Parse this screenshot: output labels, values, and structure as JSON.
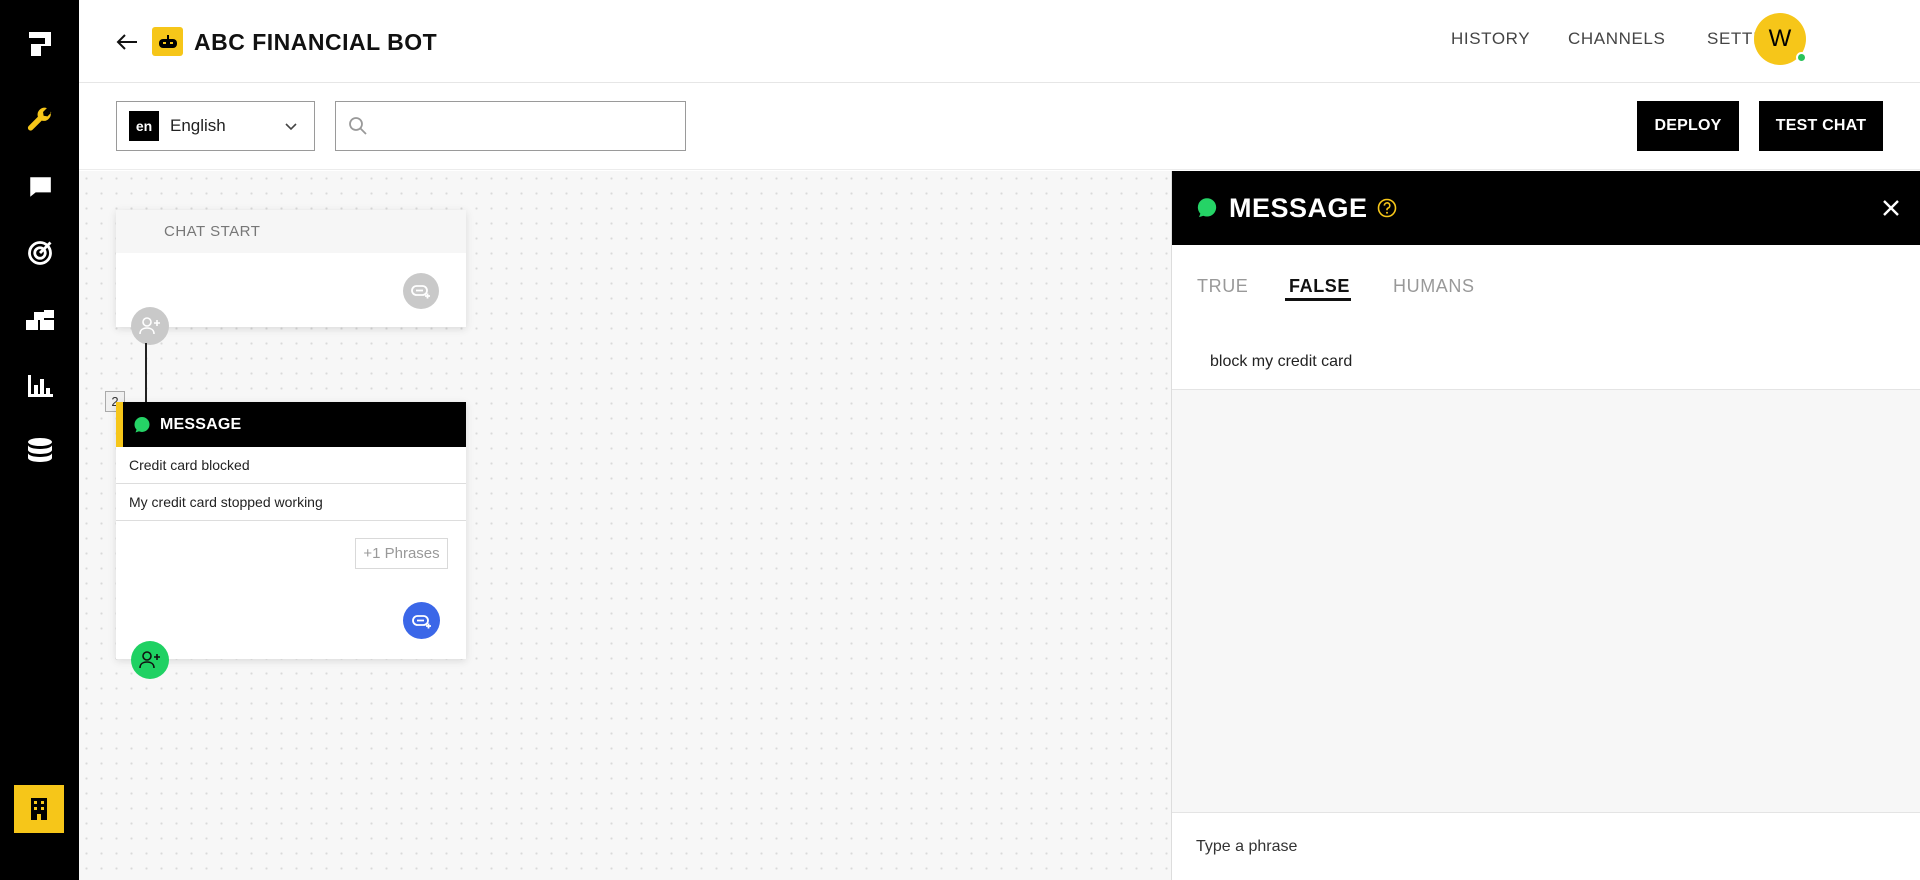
{
  "header": {
    "title": "ABC FINANCIAL BOT",
    "nav": [
      "HISTORY",
      "CHANNELS",
      "SETTINGS"
    ],
    "avatar_initial": "W"
  },
  "toolbar": {
    "language_code": "en",
    "language_name": "English",
    "search_placeholder": "",
    "deploy_label": "DEPLOY",
    "test_chat_label": "TEST CHAT"
  },
  "canvas": {
    "start_node": {
      "title": "CHAT START"
    },
    "message_node": {
      "step_number": "2",
      "title": "MESSAGE",
      "phrases": [
        "Credit card blocked",
        "My credit card stopped working"
      ],
      "more_phrases_label": "+1 Phrases"
    }
  },
  "panel": {
    "title": "MESSAGE",
    "tabs": [
      "TRUE",
      "FALSE",
      "HUMANS"
    ],
    "active_tab": "FALSE",
    "phrase": "block my credit card",
    "input_placeholder": "Type a phrase"
  },
  "colors": {
    "accent_yellow": "#f6c619",
    "primary_black": "#000000",
    "online_green": "#29c35b",
    "whatsapp_green": "#25d366",
    "connector_blue": "#3b67e8",
    "add_user_green": "#1fd163"
  }
}
